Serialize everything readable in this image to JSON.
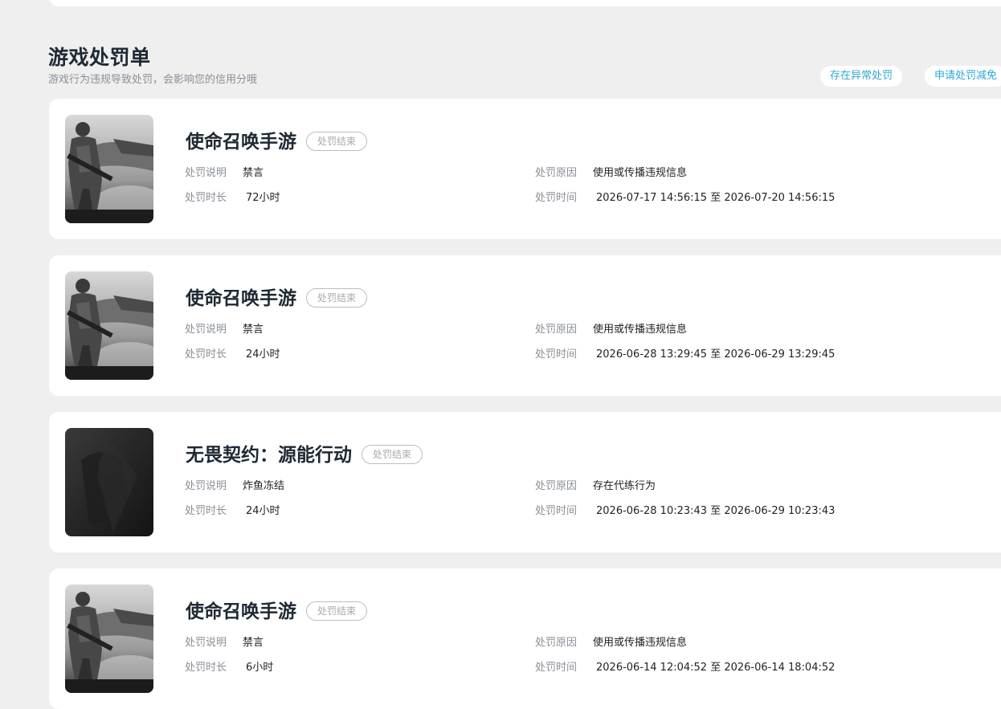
{
  "section": {
    "title": "游戏处罚单",
    "subtitle": "游戏行为违规导致处罚，会影响您的信用分哦",
    "button_abnormal": "存在异常处罚",
    "button_reduce": "申请处罚减免"
  },
  "labels": {
    "desc": "处罚说明",
    "duration": "处罚时长",
    "reason": "处罚原因",
    "time": "处罚时间"
  },
  "records": [
    {
      "game": "使命召唤手游",
      "status": "处罚结束",
      "desc": "禁言",
      "duration": "72小时",
      "reason": "使用或传播违规信息",
      "time": "2026-07-17 14:56:15 至 2026-07-20 14:56:15"
    },
    {
      "game": "使命召唤手游",
      "status": "处罚结束",
      "desc": "禁言",
      "duration": "24小时",
      "reason": "使用或传播违规信息",
      "time": "2026-06-28 13:29:45 至 2026-06-29 13:29:45"
    },
    {
      "game": "无畏契约：源能行动",
      "status": "处罚结束",
      "desc": "炸鱼冻结",
      "duration": "24小时",
      "reason": "存在代练行为",
      "time": "2026-06-28 10:23:43 至 2026-06-29 10:23:43"
    },
    {
      "game": "使命召唤手游",
      "status": "处罚结束",
      "desc": "禁言",
      "duration": "6小时",
      "reason": "使用或传播违规信息",
      "time": "2026-06-14 12:04:52 至 2026-06-14 18:04:52"
    }
  ]
}
